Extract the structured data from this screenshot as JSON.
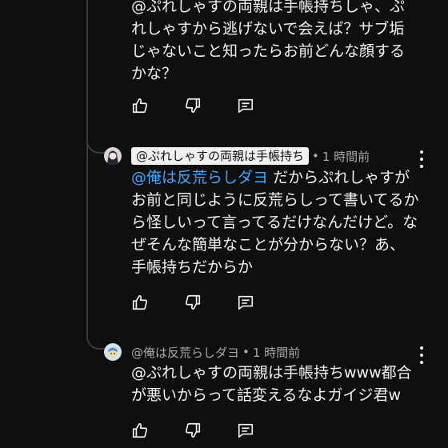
{
  "comment1": {
    "text": "@ぷれしゃすの両親は手帳持ちしゃ、ぷれしゃすから逃げないで会えば？サブ垢じゃないこと知ったらお前どんな顔するかな？"
  },
  "comment2": {
    "reply_to_chip": "@ぷれしゃすの両親は手帳持ち",
    "separator": "•",
    "time": "1 時間前",
    "mention": "@俺は反荒らしダヨ",
    "text": "だからぷれしゃすがお前と同じように反荒らしって書いてるから怪しいって言ってるだけなんだけど。なぜそんな簡単なことが分からない？あ、手帳持ちだからか"
  },
  "comment3": {
    "author": "@俺は反荒らしダヨ",
    "separator": "•",
    "time": "1 時間前",
    "text": "@ぷれしゃすの両親は手帳持ちwww都合が悪いからって話変えるなよガイジ君w"
  },
  "icons": {
    "like": "thumbs-up-icon",
    "dislike": "thumbs-down-icon",
    "reply": "reply-comment-icon",
    "menu": "more-vertical-icon"
  },
  "colors": {
    "background": "#0f0f0f",
    "text": "#f1f1f1",
    "secondary_text": "#aaaaaa",
    "mention_link": "#3ea6ff",
    "thread_line": "#3a3a3a"
  }
}
